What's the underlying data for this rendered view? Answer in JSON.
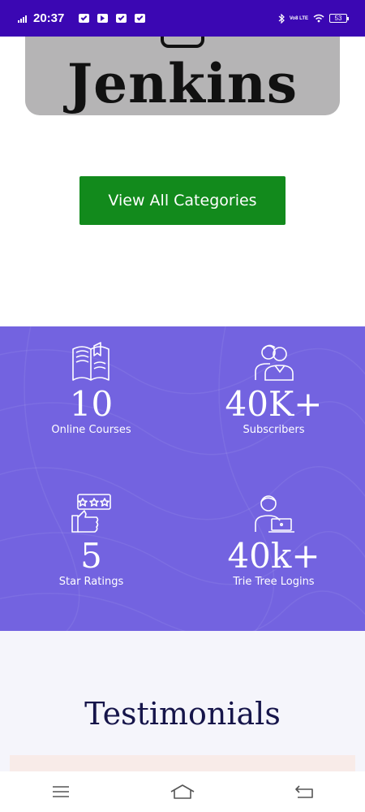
{
  "status_bar": {
    "time": "20:37",
    "network": "Vo8 LTE",
    "battery": "53"
  },
  "hero": {
    "image_text": "Jenkins"
  },
  "cta": {
    "label": "View All Categories"
  },
  "stats": [
    {
      "value": "10",
      "label": "Online Courses",
      "icon": "book-icon"
    },
    {
      "value": "40K+",
      "label": "Subscribers",
      "icon": "group-users-icon"
    },
    {
      "value": "5",
      "label": "Star Ratings",
      "icon": "thumbs-up-rating-icon"
    },
    {
      "value": "40k+",
      "label": "Trie Tree Logins",
      "icon": "laptop-user-icon"
    }
  ],
  "testimonials": {
    "heading": "Testimonials"
  },
  "colors": {
    "status_bar": "#3b07b3",
    "cta": "#128a1c",
    "stats_bg": "#7363e0",
    "heading": "#16154a"
  }
}
